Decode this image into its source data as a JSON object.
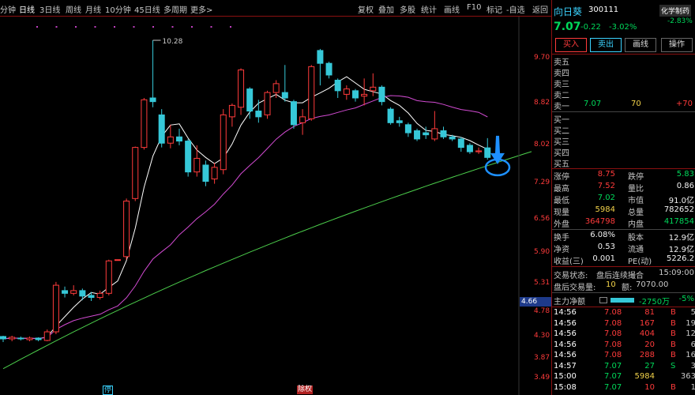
{
  "toolbar": {
    "tabs": [
      "分钟",
      "日线",
      "3日线",
      "周线",
      "月线",
      "10分钟",
      "45日线",
      "多周期",
      "更多>"
    ],
    "active_tab": "日线",
    "right_buttons": [
      "复权",
      "叠加",
      "多股",
      "统计",
      "画线",
      "F10",
      "标记",
      "-自选",
      "返回"
    ]
  },
  "chart": {
    "max_label": "10.28",
    "price_axis": [
      "9.70",
      "8.82",
      "8.02",
      "7.29",
      "6.56",
      "5.90",
      "5.31",
      "4.78",
      "4.30",
      "3.87",
      "3.49"
    ],
    "current_tag": "4.66",
    "footer_labels": [
      "停",
      "除权"
    ]
  },
  "quote": {
    "name": "向日葵",
    "code": "300111",
    "badge": "化学制药",
    "price": "7.07",
    "change": "-0.22",
    "change_pct": "-3.02%",
    "badge_pct": "-2.83%",
    "buttons": [
      "买入",
      "卖出",
      "画线",
      "操作"
    ]
  },
  "orderbook": {
    "asks": [
      {
        "label": "卖五",
        "price": "",
        "vol": ""
      },
      {
        "label": "卖四",
        "price": "",
        "vol": ""
      },
      {
        "label": "卖三",
        "price": "",
        "vol": ""
      },
      {
        "label": "卖二",
        "price": "",
        "vol": ""
      },
      {
        "label": "卖一",
        "price": "7.07",
        "vol": "70"
      }
    ],
    "ask_extra": "+70",
    "bids": [
      {
        "label": "买一",
        "price": "",
        "vol": ""
      },
      {
        "label": "买二",
        "price": "",
        "vol": ""
      },
      {
        "label": "买三",
        "price": "",
        "vol": ""
      },
      {
        "label": "买四",
        "price": "",
        "vol": ""
      },
      {
        "label": "买五",
        "price": "",
        "vol": ""
      }
    ]
  },
  "stats": [
    {
      "l1": "涨停",
      "v1": "8.75",
      "l2": "跌停",
      "v2": "5.83"
    },
    {
      "l1": "最高",
      "v1": "7.52",
      "l2": "量比",
      "v2": "0.86"
    },
    {
      "l1": "最低",
      "v1": "7.02",
      "l2": "市值",
      "v2": "91.0亿"
    },
    {
      "l1": "现量",
      "v1": "5984",
      "l2": "总量",
      "v2": "782652"
    },
    {
      "l1": "外盘",
      "v1": "364798",
      "l2": "内盘",
      "v2": "417854"
    },
    {
      "l1": "换手",
      "v1": "6.08%",
      "l2": "股本",
      "v2": "12.9亿"
    },
    {
      "l1": "净资",
      "v1": "0.53",
      "l2": "流通",
      "v2": "12.9亿"
    },
    {
      "l1": "收益(三)",
      "v1": "0.001",
      "l2": "PE(动)",
      "v2": "5226.2"
    }
  ],
  "status": {
    "trade_status_label": "交易状态:",
    "trade_status": "盘后连续撮合",
    "time": "15:09:00",
    "after_label": "盘后交易量:",
    "after_vol": "10",
    "amount_label": "额:",
    "amount": "7070.00"
  },
  "net_flow": {
    "label": "主力净额",
    "value": "-2750万",
    "pct": "-5%"
  },
  "ticks": [
    {
      "time": "14:56",
      "price": "7.08",
      "vol": "81",
      "side": "B",
      "extra": "5"
    },
    {
      "time": "14:56",
      "price": "7.08",
      "vol": "167",
      "side": "B",
      "extra": "19"
    },
    {
      "time": "14:56",
      "price": "7.08",
      "vol": "404",
      "side": "B",
      "extra": "12"
    },
    {
      "time": "14:56",
      "price": "7.08",
      "vol": "20",
      "side": "B",
      "extra": "6"
    },
    {
      "time": "14:56",
      "price": "7.08",
      "vol": "288",
      "side": "B",
      "extra": "16"
    },
    {
      "time": "14:57",
      "price": "7.07",
      "vol": "27",
      "side": "S",
      "extra": "3"
    },
    {
      "time": "15:00",
      "price": "7.07",
      "vol": "5984",
      "side": "",
      "extra": "363"
    },
    {
      "time": "15:08",
      "price": "7.07",
      "vol": "10",
      "side": "B",
      "extra": "1"
    }
  ],
  "candles": [
    {
      "o": 3.99,
      "c": 3.96,
      "h": 4.0,
      "l": 3.92
    },
    {
      "o": 3.96,
      "c": 3.98,
      "h": 4.0,
      "l": 3.93
    },
    {
      "o": 3.97,
      "c": 3.96,
      "h": 3.99,
      "l": 3.94
    },
    {
      "o": 3.95,
      "c": 3.97,
      "h": 3.99,
      "l": 3.93
    },
    {
      "o": 3.97,
      "c": 3.95,
      "h": 3.98,
      "l": 3.93
    },
    {
      "o": 3.94,
      "c": 4.05,
      "h": 4.08,
      "l": 3.93
    },
    {
      "o": 4.05,
      "c": 4.7,
      "h": 4.75,
      "l": 4.02
    },
    {
      "o": 4.62,
      "c": 4.58,
      "h": 4.68,
      "l": 4.52
    },
    {
      "o": 4.58,
      "c": 4.62,
      "h": 4.7,
      "l": 4.55
    },
    {
      "o": 4.62,
      "c": 4.54,
      "h": 4.65,
      "l": 4.48
    },
    {
      "o": 4.55,
      "c": 4.52,
      "h": 4.6,
      "l": 4.47
    },
    {
      "o": 4.52,
      "c": 4.58,
      "h": 4.62,
      "l": 4.49
    },
    {
      "o": 4.58,
      "c": 5.08,
      "h": 5.1,
      "l": 4.55
    },
    {
      "o": 5.1,
      "c": 5.1,
      "h": 5.1,
      "l": 5.1
    },
    {
      "o": 5.15,
      "c": 6.15,
      "h": 6.2,
      "l": 5.1
    },
    {
      "o": 6.2,
      "c": 7.3,
      "h": 7.32,
      "l": 6.15
    },
    {
      "o": 7.3,
      "c": 8.5,
      "h": 8.55,
      "l": 7.25
    },
    {
      "o": 8.55,
      "c": 8.45,
      "h": 10.28,
      "l": 8.3
    },
    {
      "o": 8.1,
      "c": 7.4,
      "h": 8.25,
      "l": 7.3
    },
    {
      "o": 7.4,
      "c": 7.55,
      "h": 7.85,
      "l": 7.28
    },
    {
      "o": 7.55,
      "c": 7.45,
      "h": 7.75,
      "l": 7.35
    },
    {
      "o": 7.45,
      "c": 6.75,
      "h": 7.5,
      "l": 6.65
    },
    {
      "o": 6.75,
      "c": 7.05,
      "h": 7.35,
      "l": 6.65
    },
    {
      "o": 6.9,
      "c": 6.55,
      "h": 7.0,
      "l": 6.45
    },
    {
      "o": 6.6,
      "c": 6.85,
      "h": 6.95,
      "l": 6.5
    },
    {
      "o": 6.8,
      "c": 8.1,
      "h": 8.25,
      "l": 6.7
    },
    {
      "o": 8.05,
      "c": 8.35,
      "h": 8.4,
      "l": 7.8
    },
    {
      "o": 8.3,
      "c": 9.35,
      "h": 9.4,
      "l": 8.1
    },
    {
      "o": 8.8,
      "c": 8.2,
      "h": 8.85,
      "l": 8.0
    },
    {
      "o": 8.2,
      "c": 8.05,
      "h": 8.5,
      "l": 7.9
    },
    {
      "o": 8.1,
      "c": 8.7,
      "h": 8.75,
      "l": 8.0
    },
    {
      "o": 8.7,
      "c": 8.95,
      "h": 9.05,
      "l": 8.55
    },
    {
      "o": 8.7,
      "c": 8.55,
      "h": 9.5,
      "l": 8.45
    },
    {
      "o": 8.45,
      "c": 7.85,
      "h": 8.5,
      "l": 7.75
    },
    {
      "o": 7.9,
      "c": 8.05,
      "h": 8.25,
      "l": 7.6
    },
    {
      "o": 8.0,
      "c": 9.45,
      "h": 9.5,
      "l": 7.95
    },
    {
      "o": 9.95,
      "c": 9.55,
      "h": 10.0,
      "l": 8.9
    },
    {
      "o": 9.55,
      "c": 9.2,
      "h": 9.6,
      "l": 9.1
    },
    {
      "o": 9.05,
      "c": 8.75,
      "h": 9.1,
      "l": 8.55
    },
    {
      "o": 8.65,
      "c": 8.8,
      "h": 8.9,
      "l": 8.5
    },
    {
      "o": 8.75,
      "c": 8.55,
      "h": 8.8,
      "l": 8.45
    },
    {
      "o": 8.6,
      "c": 8.65,
      "h": 9.1,
      "l": 8.35
    },
    {
      "o": 8.75,
      "c": 8.85,
      "h": 9.25,
      "l": 8.6
    },
    {
      "o": 8.85,
      "c": 8.45,
      "h": 8.9,
      "l": 8.35
    },
    {
      "o": 8.25,
      "c": 7.9,
      "h": 8.3,
      "l": 7.85
    },
    {
      "o": 7.95,
      "c": 7.9,
      "h": 8.05,
      "l": 7.8
    },
    {
      "o": 7.85,
      "c": 7.65,
      "h": 7.9,
      "l": 7.55
    },
    {
      "o": 7.7,
      "c": 7.5,
      "h": 7.75,
      "l": 7.45
    },
    {
      "o": 7.65,
      "c": 7.6,
      "h": 7.8,
      "l": 7.5
    },
    {
      "o": 7.5,
      "c": 7.75,
      "h": 8.2,
      "l": 7.45
    },
    {
      "o": 7.7,
      "c": 7.55,
      "h": 7.8,
      "l": 7.5
    },
    {
      "o": 7.55,
      "c": 7.5,
      "h": 7.6,
      "l": 7.45
    },
    {
      "o": 7.5,
      "c": 7.3,
      "h": 7.55,
      "l": 7.2
    },
    {
      "o": 7.35,
      "c": 7.2,
      "h": 7.4,
      "l": 7.15
    },
    {
      "o": 7.2,
      "c": 7.22,
      "h": 7.3,
      "l": 7.15
    },
    {
      "o": 7.29,
      "c": 7.07,
      "h": 7.52,
      "l": 7.02
    }
  ],
  "colors": {
    "up": "#ff3b3b",
    "down": "#36c8d8",
    "ma5": "#ffffff",
    "ma20": "#d24bd2",
    "ma60": "#4ccf4c",
    "arrow": "#1e90ff"
  }
}
